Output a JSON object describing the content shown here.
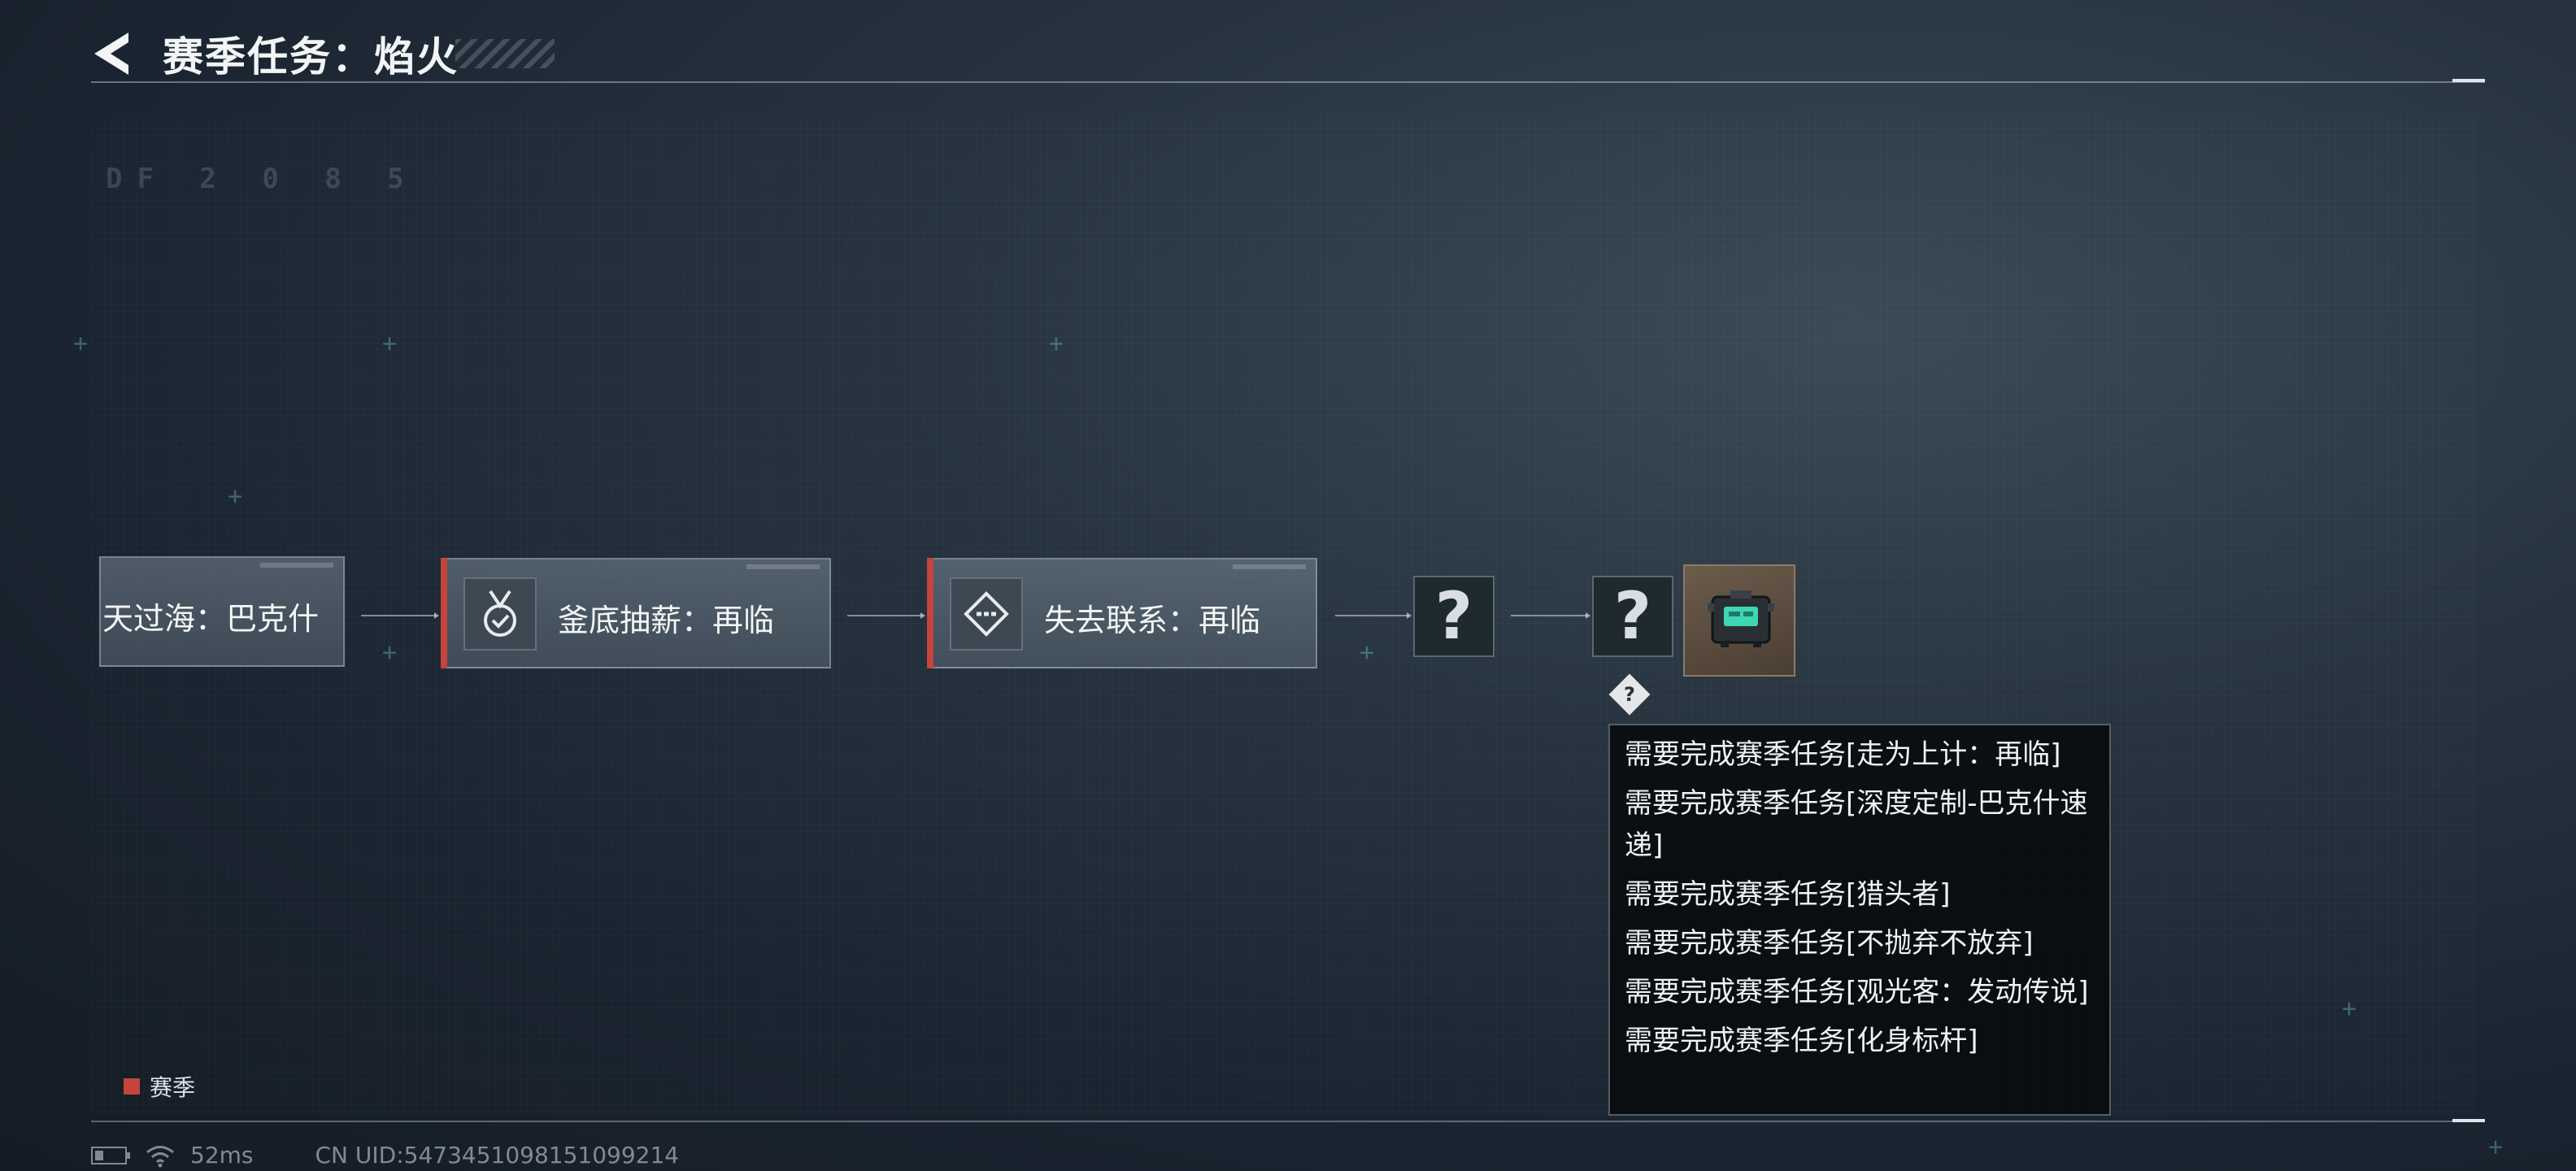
{
  "header": {
    "title": "赛季任务：焰火"
  },
  "background_hud": {
    "line1": "DF 2 0 8 5"
  },
  "nodes": [
    {
      "label": "天过海：巴克什",
      "icon": "none",
      "season": false
    },
    {
      "label": "釜底抽薪：再临",
      "icon": "medal-check-icon",
      "season": true
    },
    {
      "label": "失去联系：再临",
      "icon": "diamond-signal-icon",
      "season": true
    }
  ],
  "unknown_nodes": [
    {
      "symbol": "?"
    },
    {
      "symbol": "?"
    }
  ],
  "reward": {
    "icon": "device-item-icon"
  },
  "lock_marker": {
    "symbol": "?"
  },
  "tooltip": {
    "requirements": [
      "需要完成赛季任务[走为上计：再临]",
      "需要完成赛季任务[深度定制-巴克什速递]",
      "需要完成赛季任务[猎头者]",
      "需要完成赛季任务[不抛弃不放弃]",
      "需要完成赛季任务[观光客：发动传说]",
      "需要完成赛季任务[化身标杆]"
    ]
  },
  "legend": {
    "label": "赛季",
    "color": "#c3453d"
  },
  "status_bar": {
    "ping": "52ms",
    "uid": "CN UID:5473451098151099214"
  },
  "colors": {
    "accent_red": "#c3453d",
    "background": "#1f2b36",
    "text": "#f2f4f5"
  }
}
